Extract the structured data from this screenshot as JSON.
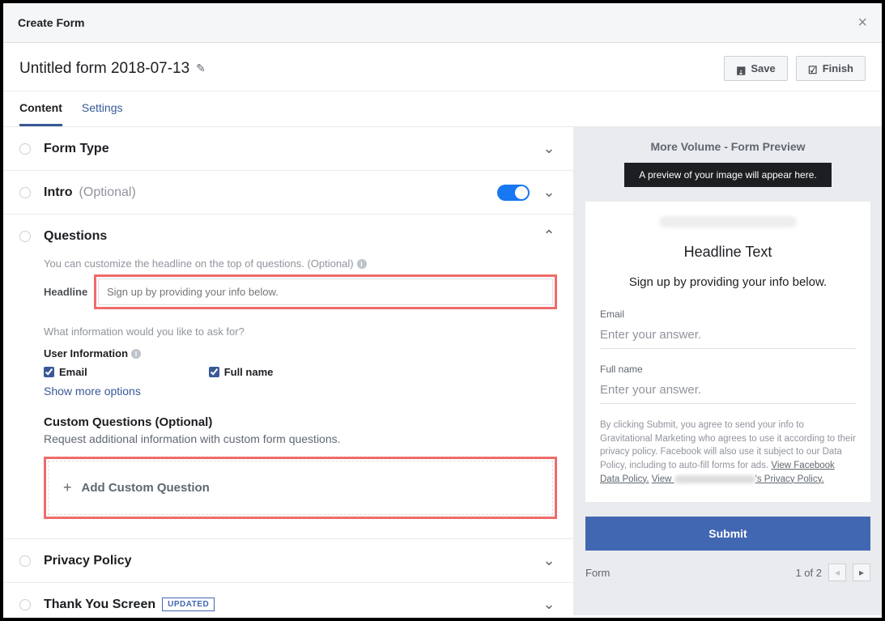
{
  "dialog": {
    "title": "Create Form"
  },
  "toolbar": {
    "form_name": "Untitled form 2018-07-13",
    "save_label": "Save",
    "finish_label": "Finish"
  },
  "tabs": {
    "content": "Content",
    "settings": "Settings"
  },
  "sections": {
    "form_type": "Form Type",
    "intro": {
      "label": "Intro",
      "optional": "(Optional)"
    },
    "questions": {
      "label": "Questions",
      "hint": "You can customize the headline on the top of questions. (Optional)",
      "headline_label": "Headline",
      "headline_placeholder": "Sign up by providing your info below.",
      "ask_label": "What information would you like to ask for?",
      "user_info_label": "User Information",
      "check_email": "Email",
      "check_fullname": "Full name",
      "show_more": "Show more options",
      "custom_heading": "Custom Questions (Optional)",
      "custom_sub": "Request additional information with custom form questions.",
      "add_custom": "Add Custom Question"
    },
    "privacy": "Privacy Policy",
    "thankyou": {
      "label": "Thank You Screen",
      "badge": "UPDATED"
    }
  },
  "preview": {
    "header": "More Volume - Form Preview",
    "strip": "A preview of your image will appear here.",
    "headline_text": "Headline Text",
    "headline_sub": "Sign up by providing your info below.",
    "email_label": "Email",
    "fullname_label": "Full name",
    "answer_placeholder": "Enter your answer.",
    "terms_pre": "By clicking Submit, you agree to send your info to Gravitational Marketing who agrees to use it according to their privacy policy. Facebook will also use it subject to our Data Policy, including to auto-fill forms for ads. ",
    "terms_link1": "View Facebook Data Policy.",
    "terms_view": "View",
    "terms_link2_suffix": "'s Privacy Policy.",
    "submit": "Submit",
    "form_label": "Form",
    "page_of": "1 of 2"
  }
}
